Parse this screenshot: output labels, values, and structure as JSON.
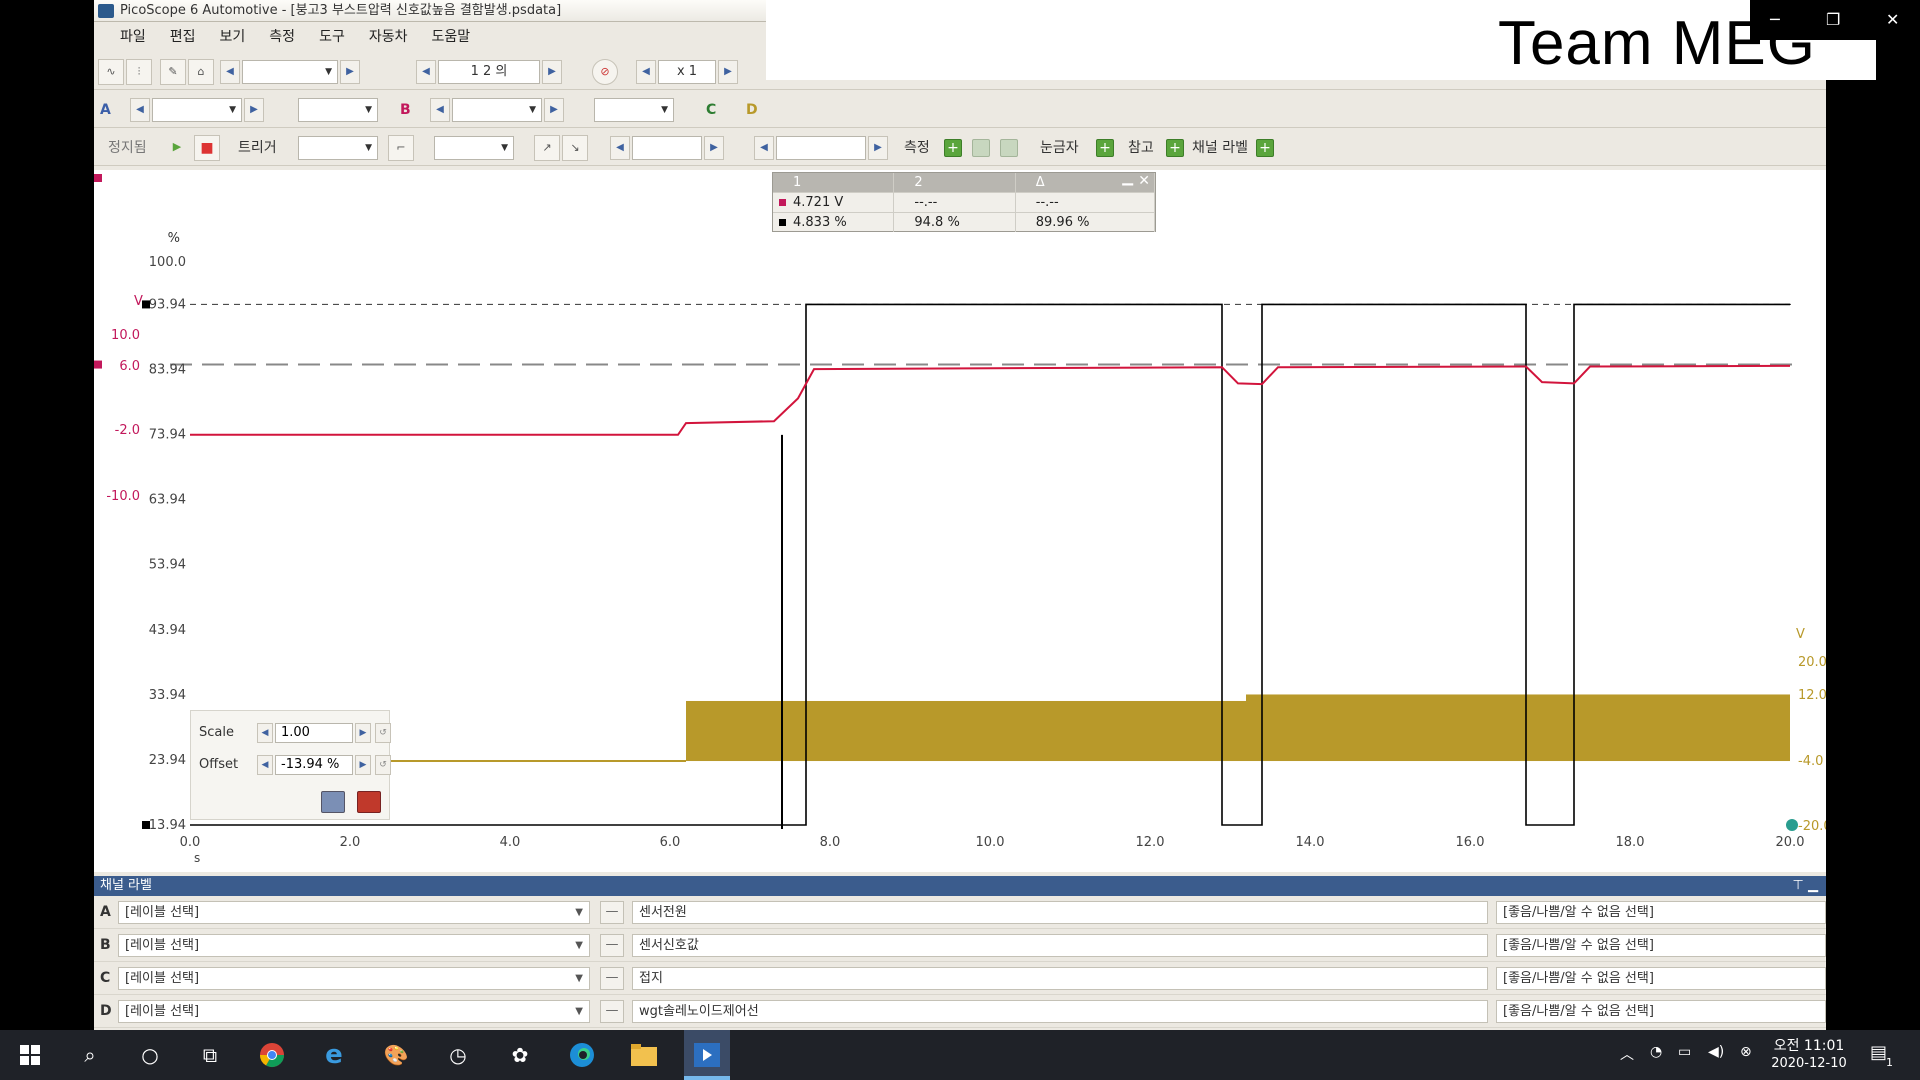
{
  "window": {
    "title": "PicoScope 6 Automotive - [붕고3 부스트압력 신호값높음 결함발생.psdata]"
  },
  "menu": [
    "파일",
    "편집",
    "보기",
    "측정",
    "도구",
    "자동차",
    "도움말"
  ],
  "toolbar1": {
    "buffer_value": "1 2 의",
    "zoom_value": "x 1"
  },
  "toolbar2": {
    "channel_a": "A",
    "channel_b": "B",
    "channel_c": "C",
    "channel_d": "D"
  },
  "toolbar3": {
    "stop_label": "정지됨",
    "trigger_label": "트리거",
    "measure_label": "측정",
    "ruler_label": "눈금자",
    "reference_label": "참고",
    "channel_label_label": "채널 라벨"
  },
  "measurement_table": {
    "headers": [
      "1",
      "2",
      "Δ"
    ],
    "rows": [
      {
        "color": "#c2185b",
        "v1": "4.721 V",
        "v2": "--.--",
        "delta": "--.--"
      },
      {
        "color": "#000000",
        "v1": "4.833 %",
        "v2": "94.8 %",
        "delta": "89.96 %"
      }
    ]
  },
  "scale_panel": {
    "scale_label": "Scale",
    "scale_value": "1.00",
    "offset_label": "Offset",
    "offset_value": "-13.94 %"
  },
  "channel_panel": {
    "title": "채널 라벨",
    "rows": [
      {
        "letter": "A",
        "label_select": "[레이블 선택]",
        "name": "센서전원",
        "quality": "[좋음/나쁨/알 수 없음 선택]"
      },
      {
        "letter": "B",
        "label_select": "[레이블 선택]",
        "name": "센서신호값",
        "quality": "[좋음/나쁨/알 수 없음 선택]"
      },
      {
        "letter": "C",
        "label_select": "[레이블 선택]",
        "name": "접지",
        "quality": "[좋음/나쁨/알 수 없음 선택]"
      },
      {
        "letter": "D",
        "label_select": "[레이블 선택]",
        "name": "wgt솔레노이드제어선",
        "quality": "[좋음/나쁨/알 수 없음 선택]"
      }
    ]
  },
  "overlay": {
    "team_text": "Team MEG"
  },
  "taskbar": {
    "time": "오전 11:01",
    "date": "2020-12-10",
    "notification_count": "1"
  },
  "chart_data": {
    "type": "line",
    "xlabel": "s",
    "x_ticks": [
      "0.0",
      "2.0",
      "4.0",
      "6.0",
      "8.0",
      "10.0",
      "12.0",
      "14.0",
      "16.0",
      "18.0",
      "20.0"
    ],
    "xlim": [
      0,
      20
    ],
    "y_percent_unit": "%",
    "y_percent_ticks": [
      "100.0",
      "93.94",
      "83.94",
      "73.94",
      "63.94",
      "53.94",
      "43.94",
      "33.94",
      "23.94",
      "13.94"
    ],
    "y_a_unit": "V",
    "y_a_ticks": [
      "10.0",
      "6.0",
      "-2.0",
      "-10.0"
    ],
    "y_d_unit": "V",
    "y_d_ticks": [
      "20.0",
      "12.0",
      "-4.0",
      "-20.0"
    ],
    "series": [
      {
        "color": "#000000",
        "x": [
          0,
          7.7,
          7.7,
          12.9,
          12.9,
          13.4,
          13.4,
          16.7,
          16.7,
          17.3,
          17.3,
          20
        ],
        "y": [
          13.94,
          13.94,
          93.94,
          93.94,
          13.94,
          13.94,
          93.94,
          93.94,
          13.94,
          13.94,
          93.94,
          93.94
        ]
      },
      {
        "color": "#d2143c",
        "x": [
          0,
          6.1,
          6.2,
          7.3,
          7.6,
          7.8,
          12.9,
          13.1,
          13.4,
          13.6,
          16.7,
          16.9,
          17.3,
          17.5,
          20
        ],
        "y": [
          73.9,
          73.9,
          75.7,
          76.0,
          79.5,
          84.0,
          84.3,
          81.8,
          81.7,
          84.3,
          84.4,
          82.0,
          81.8,
          84.4,
          84.5
        ]
      },
      {
        "color": "#b8992a",
        "x": [
          0,
          6.2,
          6.2,
          13.2,
          13.2,
          20
        ],
        "y": [
          25,
          25,
          33,
          33,
          34,
          34
        ]
      }
    ]
  }
}
